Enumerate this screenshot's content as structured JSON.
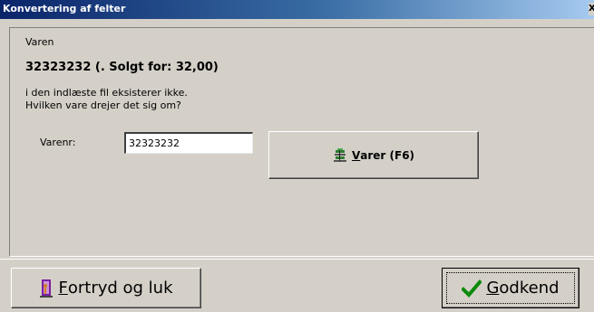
{
  "window": {
    "title": "Konvertering af felter",
    "close_glyph": "X"
  },
  "message": {
    "caption": "Varen",
    "item_line": "32323232 (. Solgt for: 32,00)",
    "line1": "i den indlæste fil eksisterer ikke.",
    "line2": "Hvilken vare drejer det sig om?"
  },
  "form": {
    "varenr_label": "Varenr:",
    "varenr_value": "32323232"
  },
  "buttons": {
    "varer": {
      "accel": "V",
      "rest": "arer (F6)",
      "icon": "inventory-icon"
    },
    "fortryd": {
      "accel": "F",
      "rest": "ortryd og luk",
      "icon": "door-exit-icon"
    },
    "godkend": {
      "accel": "G",
      "rest": "odkend",
      "icon": "checkmark-icon"
    }
  },
  "colors": {
    "face": "#d4d0c8",
    "title_start": "#0a246a",
    "title_end": "#a6caf0",
    "check_green": "#0a8a0a",
    "exit_purple": "#7b1fa2",
    "exit_orange": "#d08020"
  }
}
